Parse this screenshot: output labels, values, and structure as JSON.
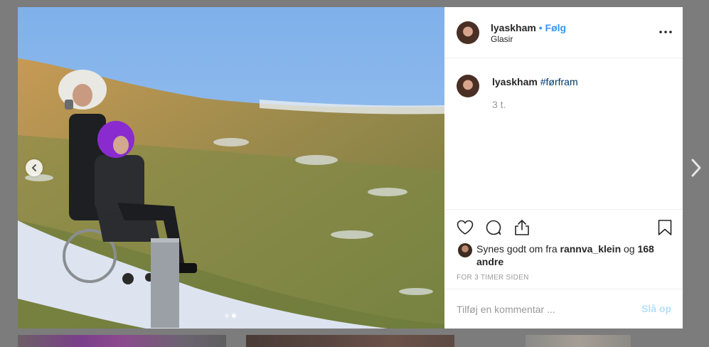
{
  "post": {
    "username": "lyaskham",
    "separator": "•",
    "follow_label": "Følg",
    "location": "Glasir",
    "more_icon": "more-options-icon",
    "caption_username": "lyaskham",
    "caption_hashtag": "#førfram",
    "caption_time": "3 t.",
    "likes_prefix": "Synes godt om fra",
    "likes_user": "rannva_klein",
    "likes_and": "og",
    "likes_others": "168 andre",
    "timestamp": "FOR 3 TIMER SIDEN",
    "comment_placeholder": "Tilføj en kommentar ...",
    "post_label": "Slå op"
  },
  "carousel": {
    "slide_count": 2,
    "active_slide": 2
  },
  "icons": {
    "prev": "chevron-left-icon",
    "next": "chevron-right-icon",
    "like": "heart-icon",
    "comment": "speech-bubble-icon",
    "share": "share-icon",
    "save": "bookmark-icon"
  },
  "colors": {
    "link_blue": "#3897f0",
    "post_disabled": "#b2dffc",
    "hashtag": "#003569",
    "muted": "#999999"
  }
}
